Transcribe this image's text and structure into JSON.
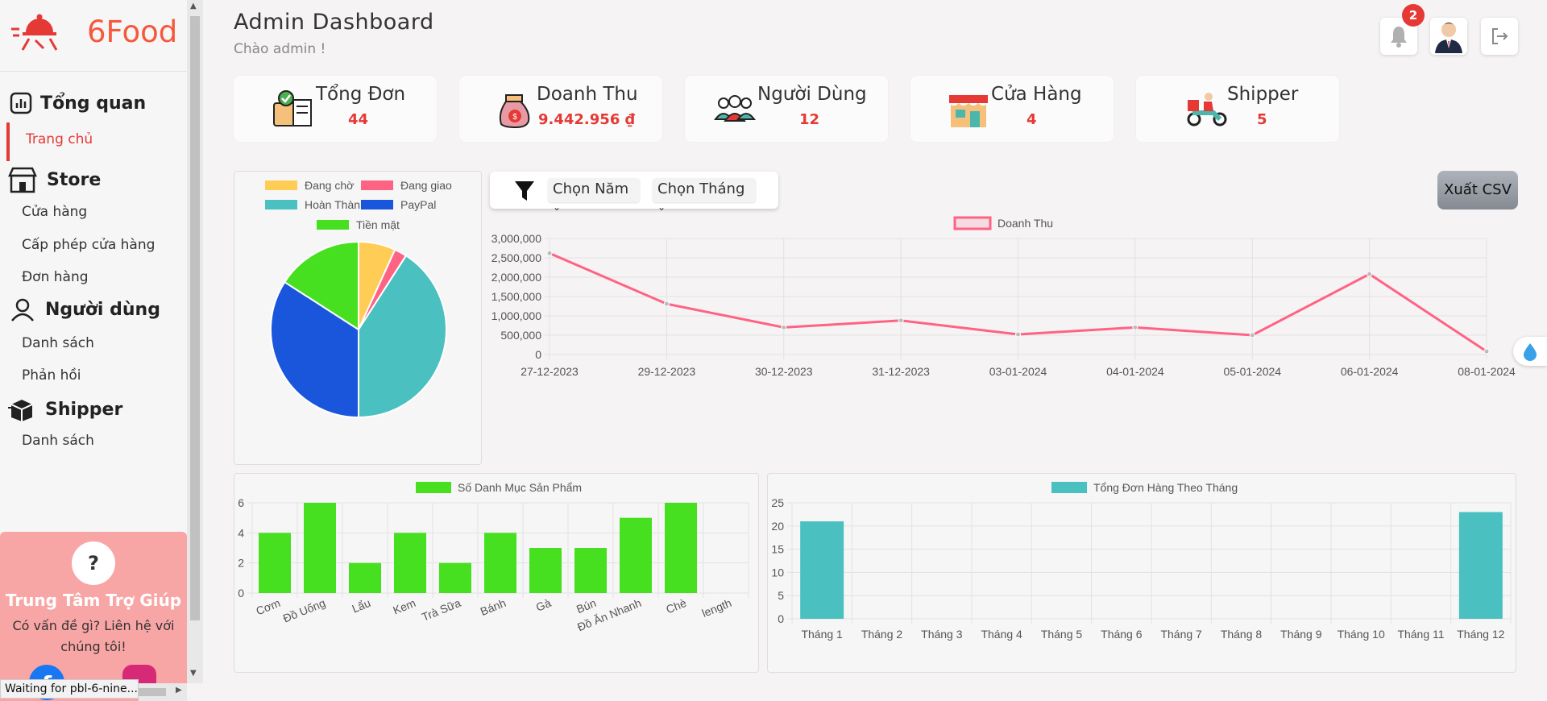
{
  "brand": {
    "name": "6Food",
    "color": "#e53935"
  },
  "sidebar": {
    "sections": [
      {
        "label": "Tổng quan",
        "icon": "chart-icon",
        "items": [
          {
            "label": "Trang chủ",
            "active": true
          }
        ]
      },
      {
        "label": "Store",
        "icon": "store-icon",
        "items": [
          {
            "label": "Cửa hàng"
          },
          {
            "label": "Cấp phép cửa hàng"
          },
          {
            "label": "Đơn hàng"
          }
        ]
      },
      {
        "label": "Người dùng",
        "icon": "user-icon",
        "items": [
          {
            "label": "Danh sách"
          },
          {
            "label": "Phản hồi"
          }
        ]
      },
      {
        "label": "Shipper",
        "icon": "box-icon",
        "items": [
          {
            "label": "Danh sách"
          }
        ]
      }
    ],
    "help": {
      "icon_text": "?",
      "title": "Trung Tâm Trợ Giúp",
      "text": "Có vấn đề gì? Liên hệ với chúng tôi!"
    }
  },
  "status_text": "Waiting for pbl-6-nine...",
  "header": {
    "title": "Admin Dashboard",
    "subtitle": "Chào admin !",
    "notification_count": "2"
  },
  "stats": [
    {
      "label": "Tổng Đơn",
      "value": "44",
      "icon": "order-icon"
    },
    {
      "label": "Doanh Thu",
      "value": "9.442.956 ₫",
      "icon": "money-bag-icon"
    },
    {
      "label": "Người Dùng",
      "value": "12",
      "icon": "users-icon"
    },
    {
      "label": "Cửa Hàng",
      "value": "4",
      "icon": "shop-icon"
    },
    {
      "label": "Shipper",
      "value": "5",
      "icon": "scooter-icon"
    }
  ],
  "filters": {
    "year": "Chọn Năm",
    "month": "Chọn Tháng"
  },
  "export_label": "Xuất CSV",
  "chart_data": [
    {
      "type": "pie",
      "categories": [
        "Đang chờ",
        "Đang giao",
        "Hoàn Thành",
        "PayPal",
        "Tiền mặt"
      ],
      "values": [
        3,
        1,
        18,
        15,
        7
      ],
      "colors": [
        "#ffcd56",
        "#ff6384",
        "#4bc0c0",
        "#1a56db",
        "#47e020"
      ],
      "legend": "top"
    },
    {
      "type": "line",
      "series": [
        {
          "name": "Doanh Thu",
          "values": [
            2620000,
            1310000,
            700000,
            880000,
            520000,
            700000,
            500000,
            2080000,
            80000
          ],
          "color": "#ff6384"
        }
      ],
      "categories": [
        "27-12-2023",
        "29-12-2023",
        "30-12-2023",
        "31-12-2023",
        "03-01-2024",
        "04-01-2024",
        "05-01-2024",
        "06-01-2024",
        "08-01-2024"
      ],
      "ylim": [
        0,
        3000000
      ],
      "yticks": [
        "3,000,000",
        "2,500,000",
        "2,000,000",
        "1,500,000",
        "1,000,000",
        "500,000",
        "0"
      ],
      "grid": true,
      "legend": "top"
    },
    {
      "type": "bar",
      "series": [
        {
          "name": "Số Danh Mục Sản Phẩm",
          "values": [
            4,
            6,
            2,
            4,
            2,
            4,
            3,
            3,
            5,
            6,
            0
          ],
          "color": "#47e020"
        }
      ],
      "categories": [
        "Cơm",
        "Đồ Uống",
        "Lẩu",
        "Kem",
        "Trà Sữa",
        "Bánh",
        "Gà",
        "Bún",
        "Đồ Ăn Nhanh",
        "Chè",
        "length"
      ],
      "ylim": [
        0,
        6
      ],
      "yticks": [
        "6",
        "4",
        "2",
        "0"
      ],
      "grid": true,
      "legend": "top"
    },
    {
      "type": "bar",
      "series": [
        {
          "name": "Tổng Đơn Hàng Theo Tháng",
          "values": [
            21,
            0,
            0,
            0,
            0,
            0,
            0,
            0,
            0,
            0,
            0,
            23
          ],
          "color": "#4bc0c0"
        }
      ],
      "categories": [
        "Tháng 1",
        "Tháng 2",
        "Tháng 3",
        "Tháng 4",
        "Tháng 5",
        "Tháng 6",
        "Tháng 7",
        "Tháng 8",
        "Tháng 9",
        "Tháng 10",
        "Tháng 11",
        "Tháng 12"
      ],
      "ylim": [
        0,
        25
      ],
      "yticks": [
        "25",
        "20",
        "15",
        "10",
        "5",
        "0"
      ],
      "grid": true,
      "legend": "top"
    }
  ]
}
